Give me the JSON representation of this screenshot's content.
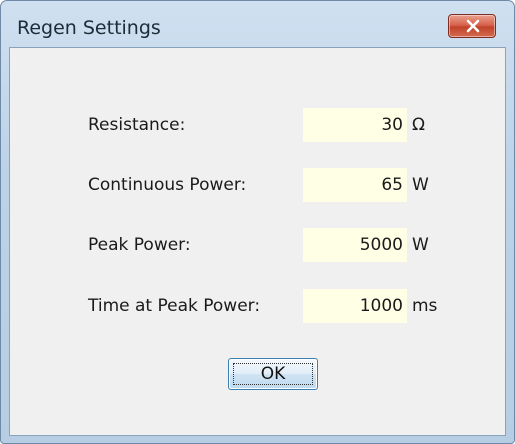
{
  "window": {
    "title": "Regen Settings",
    "close_icon": "close-icon"
  },
  "fields": [
    {
      "label": "Resistance:",
      "value": "30",
      "unit": "Ω"
    },
    {
      "label": "Continuous Power:",
      "value": "65",
      "unit": "W"
    },
    {
      "label": "Peak Power:",
      "value": "5000",
      "unit": "W"
    },
    {
      "label": "Time at Peak Power:",
      "value": "1000",
      "unit": "ms"
    }
  ],
  "buttons": {
    "ok_label": "OK"
  },
  "colors": {
    "field_background": "#ffffe6",
    "close_button": "#c9472f",
    "titlebar": "#bcd2e8",
    "client_background": "#f0f0f0"
  }
}
